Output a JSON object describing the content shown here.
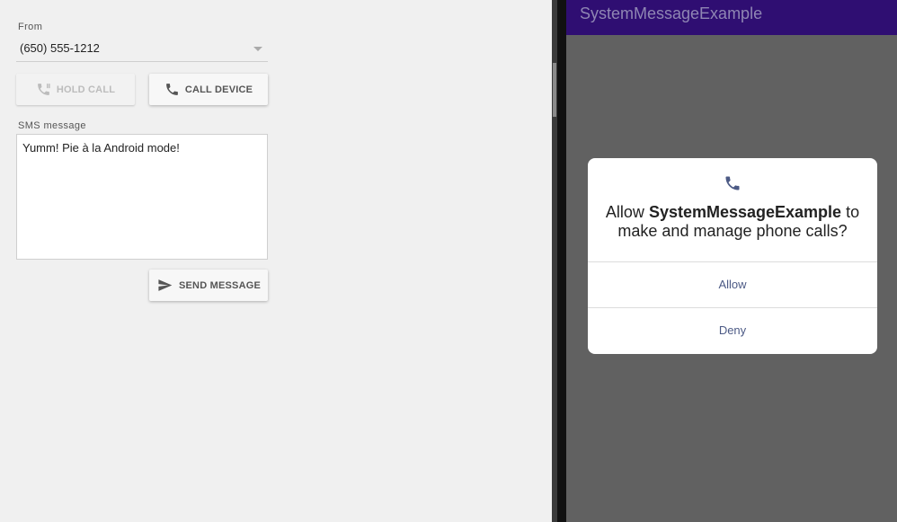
{
  "controls": {
    "from_label": "From",
    "from_value": "(650) 555-1212",
    "hold_call_label": "HOLD CALL",
    "call_device_label": "CALL DEVICE",
    "sms_label": "SMS message",
    "sms_text": "Yumm! Pie à la Android mode!",
    "send_label": "SEND MESSAGE"
  },
  "phone": {
    "app_title": "SystemMessageExample",
    "dialog": {
      "prefix": "Allow ",
      "app_name": "SystemMessageExample",
      "suffix": " to make and manage phone calls?",
      "allow_label": "Allow",
      "deny_label": "Deny"
    }
  },
  "colors": {
    "app_bar": "#2f0e72",
    "screen_scrim": "#616161",
    "dialog_button_text": "#4c5a85",
    "panel_background": "#f0f0f0"
  },
  "icons": {
    "hold_call": "phone-paused-icon",
    "call_device": "phone-icon",
    "send_message": "send-icon",
    "dialog": "phone-icon"
  }
}
